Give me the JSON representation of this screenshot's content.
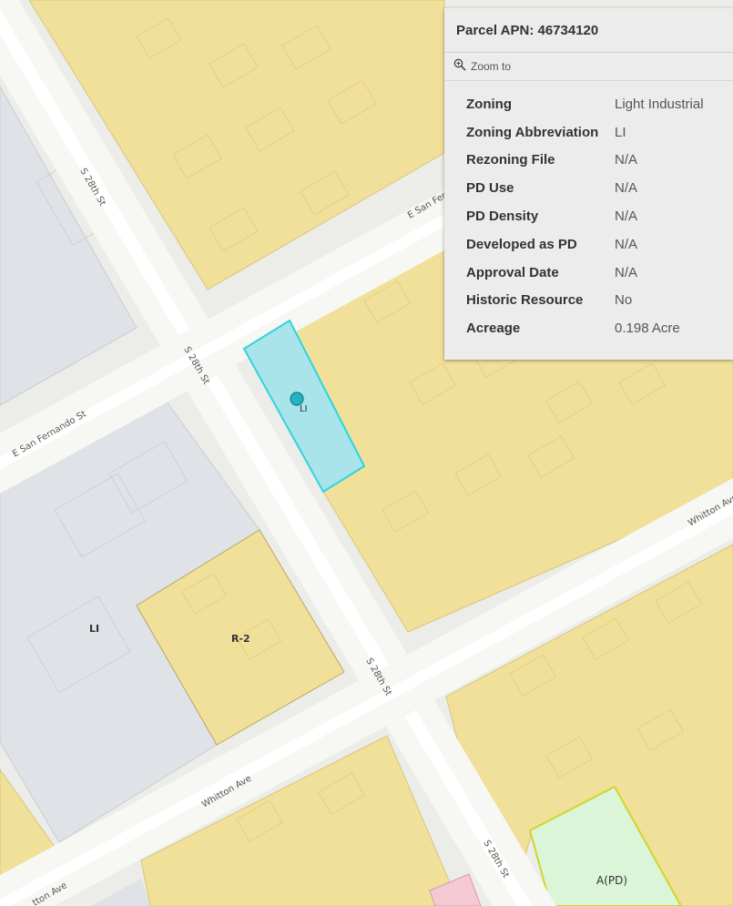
{
  "popup": {
    "title": "Parcel APN: 46734120",
    "zoom_label": "Zoom to",
    "fields": [
      {
        "label": "Zoning",
        "value": "Light Industrial"
      },
      {
        "label": "Zoning Abbreviation",
        "value": "LI"
      },
      {
        "label": "Rezoning File",
        "value": "N/A"
      },
      {
        "label": "PD Use",
        "value": "N/A"
      },
      {
        "label": "PD Density",
        "value": "N/A"
      },
      {
        "label": "Developed as PD",
        "value": "N/A"
      },
      {
        "label": "Approval Date",
        "value": "N/A"
      },
      {
        "label": "Historic Resource",
        "value": "No"
      },
      {
        "label": "Acreage",
        "value": "0.198 Acre"
      }
    ]
  },
  "map": {
    "streets": {
      "s28_a": "S 28th St",
      "s28_b": "S 28th St",
      "s28_c": "S 28th St",
      "s28_d": "S 28th St",
      "san_fern_a": "E San Fernando St",
      "san_fern_b": "E San Fer",
      "whitton_a": "Whitton Ave",
      "whitton_b": "Whitton Ave",
      "whitton_c": "tton Ave"
    },
    "zones": {
      "selected": "LI",
      "li": "LI",
      "r2": "R-2",
      "apd": "A(PD)"
    },
    "colors": {
      "residential": "#f0e09a",
      "industrial": "#dfe2e6",
      "selected": "#a8e4e9",
      "selected_outline": "#2fd4e0",
      "agricultural_pd": "#daf5d8",
      "commercial": "#f4c9d3",
      "road": "#f7f7f3"
    }
  }
}
